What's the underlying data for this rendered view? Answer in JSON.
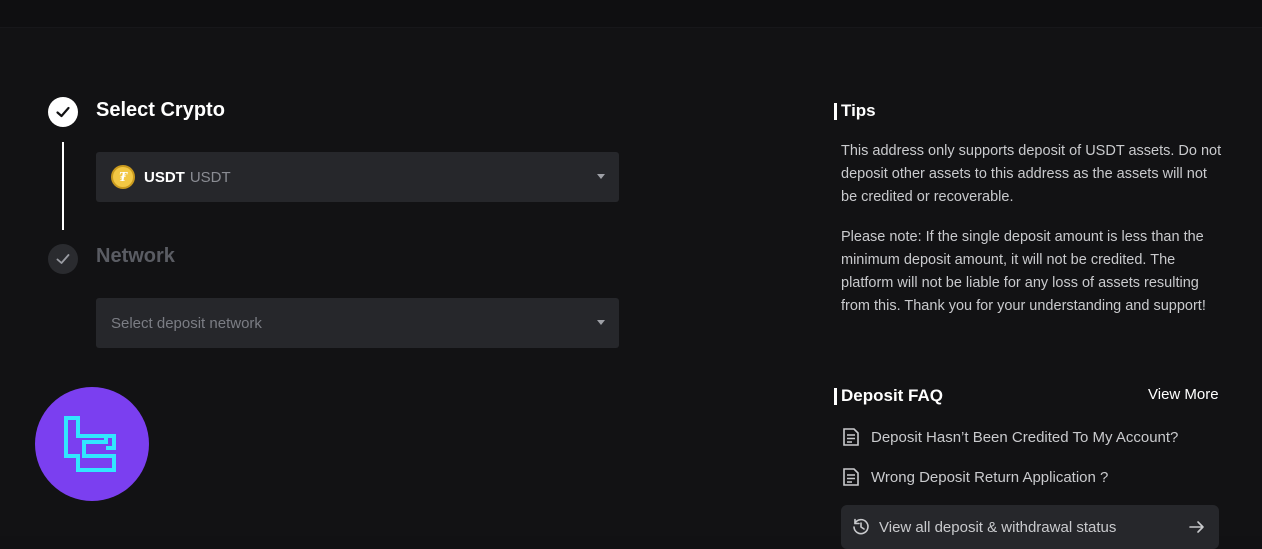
{
  "steps": {
    "select_crypto": {
      "title": "Select Crypto",
      "coin_symbol": "USDT",
      "coin_name": "USDT"
    },
    "network": {
      "title": "Network",
      "placeholder": "Select deposit network"
    }
  },
  "tips": {
    "title": "Tips",
    "paragraph1": "This address only supports deposit of USDT assets. Do not deposit other assets to this address as the assets will not be credited or recoverable.",
    "paragraph2": "Please note: If the single deposit amount is less than the minimum deposit amount, it will not be credited. The platform will not be liable for any loss of assets resulting from this. Thank you for your understanding and support!"
  },
  "faq": {
    "title": "Deposit FAQ",
    "view_more": "View More",
    "items": [
      {
        "label": "Deposit Hasn’t Been Credited To My Account?"
      },
      {
        "label": "Wrong Deposit Return Application ?"
      }
    ],
    "status_button": "View all deposit & withdrawal status"
  },
  "colors": {
    "background": "#121214",
    "panel": "#26272b",
    "logo_bg": "#7b3ff0",
    "logo_fg": "#32e6ff",
    "coin": "#f2c744"
  }
}
